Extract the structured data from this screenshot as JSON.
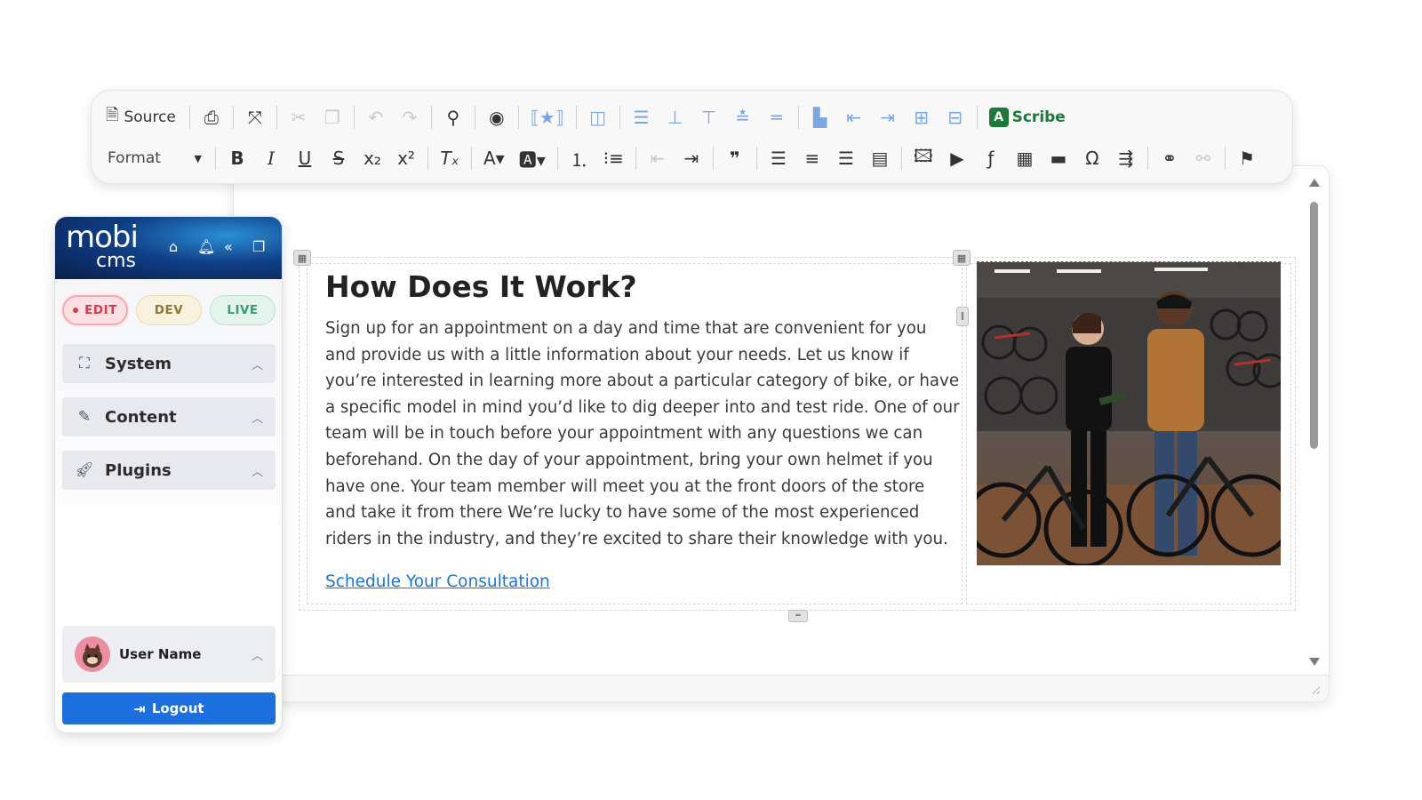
{
  "toolbar": {
    "source_label": "Source",
    "format_label": "Format",
    "scribe_label": "Scribe",
    "colors": {
      "disabled": "#c9c9c9",
      "blue_tools": "#7aa7e0",
      "scribe_green": "#1b7a3a"
    }
  },
  "content": {
    "heading": "How Does It Work?",
    "body": "Sign up for an appointment on a day and time that are convenient for you and provide us with a little information about your needs.  Let us know if you’re interested in learning more about a particular category of bike, or have a specific model in mind you’d like to dig deeper into and test ride. One of our team will be in touch before your appointment with any questions we can beforehand. On the day of your appointment, bring your own helmet if you have one. Your team member will meet you at the front doors of the store and take it from there We’re lucky to have some of the most experienced riders in the industry, and they’re excited to share their knowledge with you.",
    "link_text": "Schedule Your Consultation",
    "link_color": "#1a73e8"
  },
  "sidebar": {
    "logo_top": "mobi",
    "logo_bottom": "cms",
    "env": {
      "edit": "EDIT",
      "dev": "DEV",
      "live": "LIVE"
    },
    "sections": [
      {
        "label": "System",
        "icon": "sitemap-icon"
      },
      {
        "label": "Content",
        "icon": "edit-icon"
      },
      {
        "label": "Plugins",
        "icon": "rocket-icon"
      }
    ],
    "user_name": "User Name",
    "logout_label": "Logout",
    "colors": {
      "logout": "#1d6fe0",
      "edit": "#d9394e",
      "dev": "#8a7a36",
      "live": "#3a9a72"
    }
  }
}
